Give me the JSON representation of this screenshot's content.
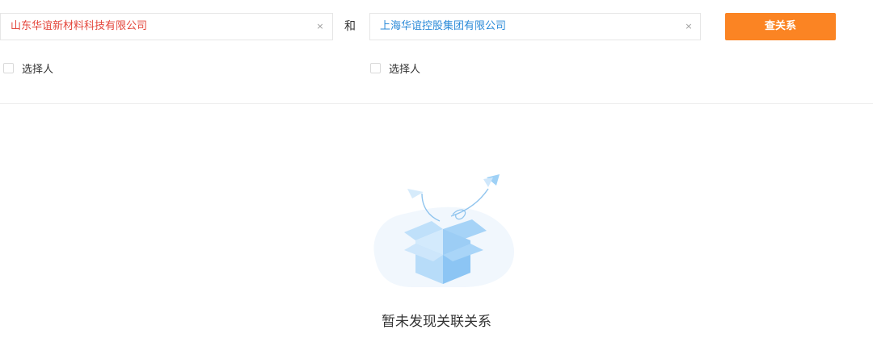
{
  "search": {
    "company_a": "山东华谊新材料科技有限公司",
    "company_b": "上海华谊控股集团有限公司",
    "and_label": "和",
    "query_button": "查关系",
    "clear_symbol": "×"
  },
  "options": {
    "select_person_a": "选择人",
    "select_person_b": "选择人"
  },
  "empty_state": {
    "message": "暂未发现关联关系",
    "icon": "empty-box-icon"
  },
  "colors": {
    "accent": "#fb8423",
    "company_a_text": "#e4463b",
    "company_b_text": "#2a8ad8"
  }
}
